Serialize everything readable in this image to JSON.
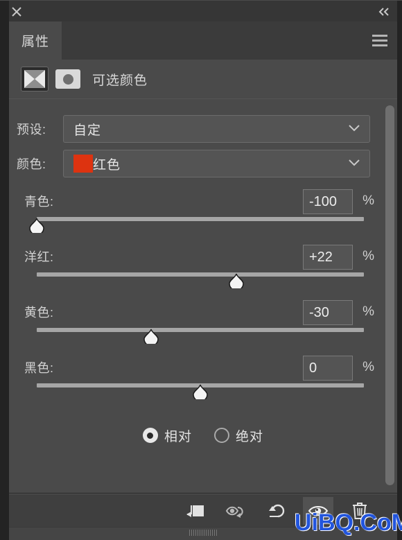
{
  "window": {
    "close_icon": "close-icon",
    "collapse_icon": "collapse-double-chevron-icon"
  },
  "tabs": [
    {
      "label": "属性",
      "active": true
    }
  ],
  "panel_menu_icon": "hamburger-menu-icon",
  "adjustment": {
    "layer_thumbnail_icon": "adjustment-layer-thumbnail",
    "mask_thumbnail_icon": "layer-mask-thumbnail",
    "title": "可选颜色"
  },
  "fields": {
    "preset_label": "预设:",
    "preset_value": "自定",
    "color_label": "颜色:",
    "color_value": "红色",
    "color_swatch_hex": "#dd3310"
  },
  "sliders": [
    {
      "label": "青色:",
      "value": "-100",
      "unit": "%",
      "pos_pct": 0
    },
    {
      "label": "洋红:",
      "value": "+22",
      "unit": "%",
      "pos_pct": 61
    },
    {
      "label": "黄色:",
      "value": "-30",
      "unit": "%",
      "pos_pct": 35
    },
    {
      "label": "黑色:",
      "value": "0",
      "unit": "%",
      "pos_pct": 50
    }
  ],
  "method": {
    "options": [
      {
        "label": "相对",
        "selected": true
      },
      {
        "label": "绝对",
        "selected": false
      }
    ]
  },
  "toolbar": [
    {
      "name": "clip-to-layer-icon",
      "active": false
    },
    {
      "name": "view-previous-state-icon",
      "active": false
    },
    {
      "name": "reset-icon",
      "active": false
    },
    {
      "name": "toggle-visibility-icon",
      "active": true
    },
    {
      "name": "delete-icon",
      "active": false
    }
  ],
  "watermark": "UiBQ.CoM",
  "theme": {
    "panel_bg": "#4a4a4a",
    "header_bg": "#3b3b3b",
    "tab_active_bg": "#4a4a4a",
    "field_bg": "#545454",
    "text": "#d2d2d2",
    "accent_red": "#dd3310",
    "watermark_blue": "#2255dd"
  }
}
